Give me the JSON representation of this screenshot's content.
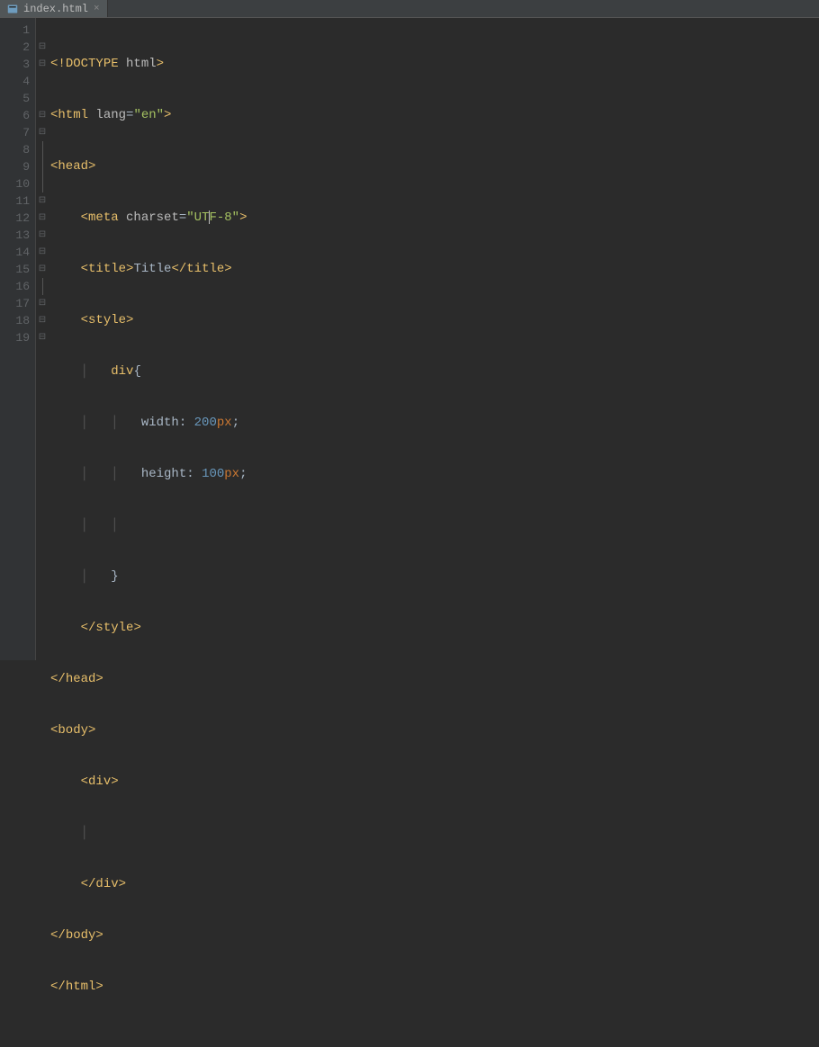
{
  "tab": {
    "filename": "index.html",
    "close_glyph": "×"
  },
  "gutter": {
    "lines": [
      "1",
      "2",
      "3",
      "4",
      "5",
      "6",
      "7",
      "8",
      "9",
      "10",
      "11",
      "12",
      "13",
      "14",
      "15",
      "16",
      "17",
      "18",
      "19"
    ]
  },
  "code": {
    "l1": {
      "a": "<!",
      "b": "DOCTYPE ",
      "c": "html",
      "d": ">"
    },
    "l2": {
      "a": "<",
      "b": "html ",
      "c": "lang",
      "d": "=",
      "e": "\"en\"",
      "f": ">"
    },
    "l3": {
      "a": "<",
      "b": "head",
      "c": ">"
    },
    "l4": {
      "a": "<",
      "b": "meta ",
      "c": "charset",
      "d": "=",
      "e": "\"UTF-8\"",
      "f": ">"
    },
    "l5": {
      "a": "<",
      "b": "title",
      "c": ">",
      "d": "Title",
      "e": "</",
      "f": "title",
      "g": ">"
    },
    "l6": {
      "a": "<",
      "b": "style",
      "c": ">"
    },
    "l7": {
      "a": "div",
      "b": "{"
    },
    "l8": {
      "a": "width",
      "b": ": ",
      "c": "200",
      "d": "px",
      "e": ";"
    },
    "l9": {
      "a": "height",
      "b": ": ",
      "c": "100",
      "d": "px",
      "e": ";"
    },
    "l11": {
      "a": "}"
    },
    "l12": {
      "a": "</",
      "b": "style",
      "c": ">"
    },
    "l13": {
      "a": "</",
      "b": "head",
      "c": ">"
    },
    "l14": {
      "a": "<",
      "b": "body",
      "c": ">"
    },
    "l15": {
      "a": "<",
      "b": "div",
      "c": ">"
    },
    "l17": {
      "a": "</",
      "b": "div",
      "c": ">"
    },
    "l18": {
      "a": "</",
      "b": "body",
      "c": ">"
    },
    "l19": {
      "a": "</",
      "b": "html",
      "c": ">"
    }
  }
}
